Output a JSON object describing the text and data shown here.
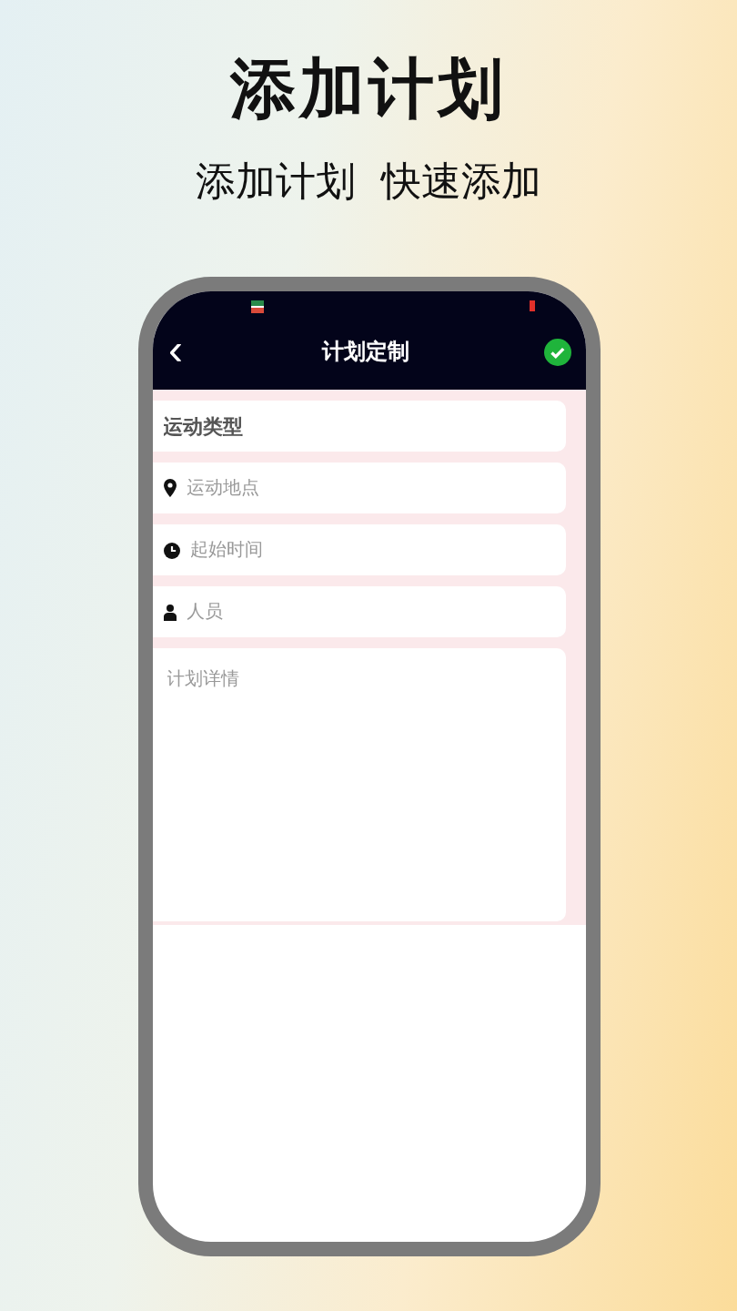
{
  "headline": "添加计划",
  "subheadline": "添加计划  快速添加",
  "nav": {
    "back": "‹",
    "title": "计划定制"
  },
  "fields": [
    {
      "kind": "select",
      "value": "运动类型"
    },
    {
      "kind": "location",
      "placeholder": "运动地点"
    },
    {
      "kind": "time",
      "placeholder": "起始时间"
    },
    {
      "kind": "person",
      "placeholder": "人员"
    },
    {
      "kind": "textarea",
      "placeholder": "计划详情"
    }
  ]
}
